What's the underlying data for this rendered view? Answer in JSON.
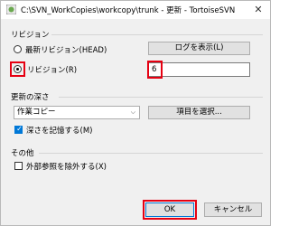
{
  "window": {
    "title": "C:\\SVN_WorkCopies\\workcopy\\trunk - 更新 - TortoiseSVN",
    "close_symbol": "✕",
    "app_icon": "tortoisesvn-icon"
  },
  "revision_group": {
    "label": "リビジョン",
    "head_option": "最新リビジョン(HEAD)",
    "revision_option": "リビジョン(R)",
    "selected": "revision",
    "show_log_button": "ログを表示(L)",
    "revision_value": "6"
  },
  "depth_group": {
    "label": "更新の深さ",
    "depth_select": "作業コピー",
    "choose_items_button": "項目を選択...",
    "remember_depth_label": "深さを記憶する(M)",
    "remember_depth_checked": true
  },
  "other_group": {
    "label": "その他",
    "ignore_externals_label": "外部参照を除外する(X)",
    "ignore_externals_checked": false
  },
  "buttons": {
    "ok": "OK",
    "cancel": "キャンセル"
  },
  "colors": {
    "highlight": "#e60012",
    "accent": "#0078d7"
  }
}
